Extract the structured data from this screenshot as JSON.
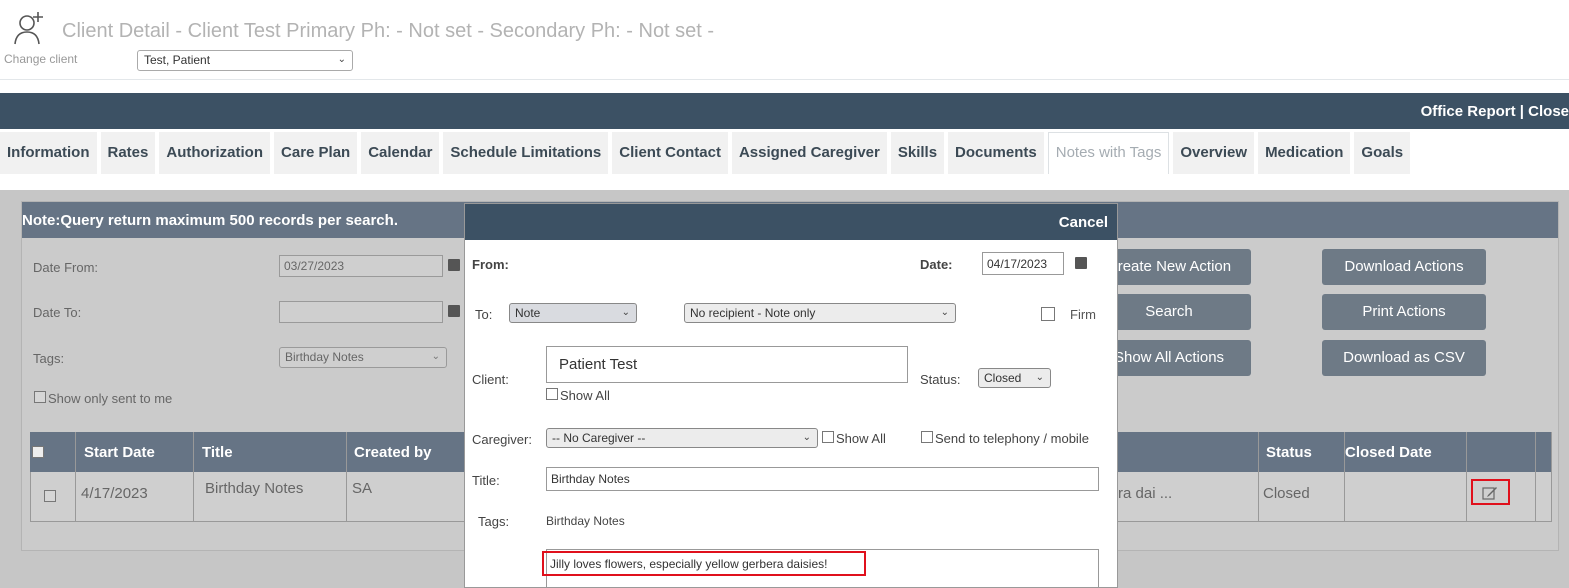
{
  "header": {
    "title": "Client Detail - Client Test Primary Ph: - Not set - Secondary Ph: - Not set -",
    "change_client_label": "Change client",
    "client_select_value": "Test, Patient",
    "office_report": "Office Report |   Close"
  },
  "tabs": [
    "Information",
    "Rates",
    "Authorization",
    "Care Plan",
    "Calendar",
    "Schedule Limitations",
    "Client Contact",
    "Assigned Caregiver",
    "Skills",
    "Documents",
    "Notes with Tags",
    "Overview",
    "Medication",
    "Goals"
  ],
  "active_tab": "Notes with Tags",
  "filters": {
    "note": "Note:Query return maximum 500 records per search.",
    "date_from_label": "Date From:",
    "date_from_value": "03/27/2023",
    "date_to_label": "Date To:",
    "date_to_value": "",
    "tags_label": "Tags:",
    "tags_value": "Birthday Notes",
    "show_only_sent": "Show only sent to me"
  },
  "buttons": {
    "create": "Create New Action",
    "search": "Search",
    "show_all": "Show All Actions",
    "download_actions": "Download Actions",
    "print_actions": "Print Actions",
    "download_csv": "Download as CSV"
  },
  "table": {
    "columns": [
      "Start Date",
      "Title",
      "Created by",
      "Status",
      "Closed Date"
    ],
    "rows": [
      {
        "start_date": "4/17/2023",
        "title": "Birthday Notes",
        "created_by": "SA",
        "text_snippet": "ra dai ...",
        "status": "Closed",
        "closed_date": ""
      }
    ]
  },
  "modal": {
    "cancel": "Cancel",
    "from_label": "From:",
    "date_label": "Date:",
    "date_value": "04/17/2023",
    "to_label": "To:",
    "to_value": "Note",
    "recipient_value": "No recipient - Note only",
    "firm_label": "Firm",
    "client_label": "Client:",
    "client_value": "Patient Test",
    "show_all_label": "Show All",
    "status_label": "Status:",
    "status_value": "Closed",
    "caregiver_label": "Caregiver:",
    "caregiver_value": "-- No Caregiver --",
    "caregiver_show_all": "Show All",
    "send_telephony": "Send to telephony / mobile",
    "title_label": "Title:",
    "title_value": "Birthday Notes",
    "tags_label": "Tags:",
    "tags_value": "Birthday Notes",
    "note_text": "Jilly loves flowers, especially yellow gerbera daisies!"
  },
  "colors": {
    "navy": "#3c5164",
    "slate": "#667485",
    "highlight": "#e0101c"
  }
}
